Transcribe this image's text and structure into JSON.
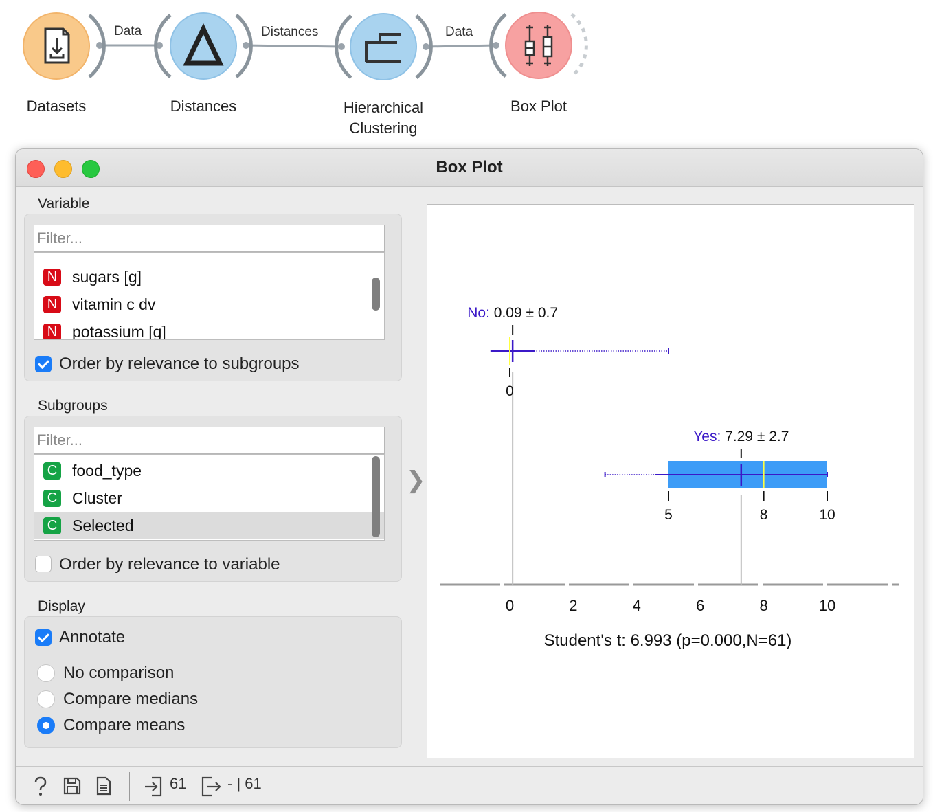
{
  "workflow": {
    "nodes": [
      {
        "label": "Datasets",
        "icon": "dataset-file-icon",
        "color": "#f9c98a"
      },
      {
        "label": "Distances",
        "icon": "triangle-delta-icon",
        "color": "#a9d3ef"
      },
      {
        "label_line1": "Hierarchical",
        "label_line2": "Clustering",
        "icon": "dendrogram-icon",
        "color": "#a9d3ef"
      },
      {
        "label": "Box Plot",
        "icon": "box-plot-icon",
        "color": "#f7a1a1"
      }
    ],
    "links": [
      "Data",
      "Distances",
      "Data"
    ]
  },
  "window": {
    "title": "Box Plot",
    "colors": {
      "close": "#fe5f57",
      "minimize": "#febc2e",
      "maximize": "#28c840"
    }
  },
  "variable": {
    "section_title": "Variable",
    "filter_placeholder": "Filter...",
    "items": [
      {
        "badge": "N",
        "label": "sugars [g]"
      },
      {
        "badge": "N",
        "label": "vitamin c dv"
      },
      {
        "badge": "N",
        "label": "potassium [g]"
      }
    ],
    "order_checkbox": {
      "label": "Order by relevance to subgroups",
      "checked": true
    }
  },
  "subgroups": {
    "section_title": "Subgroups",
    "filter_placeholder": "Filter...",
    "items": [
      {
        "badge": "C",
        "label": "food_type"
      },
      {
        "badge": "C",
        "label": "Cluster"
      },
      {
        "badge": "C",
        "label": "Selected",
        "selected": true
      }
    ],
    "order_checkbox": {
      "label": "Order by relevance to variable",
      "checked": false
    }
  },
  "display": {
    "section_title": "Display",
    "annotate": {
      "label": "Annotate",
      "checked": true
    },
    "comparison_options": [
      {
        "label": "No comparison",
        "selected": false
      },
      {
        "label": "Compare medians",
        "selected": false
      },
      {
        "label": "Compare means",
        "selected": true
      }
    ]
  },
  "chart_data": {
    "type": "box",
    "xlim": [
      -1,
      12
    ],
    "axis_ticks": [
      0,
      2,
      4,
      6,
      8,
      10
    ],
    "boxes": [
      {
        "name": "No",
        "label_value": "0.09 ± 0.7",
        "mean": 0.09,
        "sd": 0.7,
        "median": 0,
        "q1": 0,
        "q3": 0,
        "whisker_low": 0,
        "whisker_high": 0,
        "outlier_low": 0,
        "outlier_high": 5,
        "tick_labels": [
          "0"
        ]
      },
      {
        "name": "Yes",
        "label_value": "7.29 ± 2.7",
        "mean": 7.29,
        "sd": 2.7,
        "median": 8,
        "q1": 5,
        "q3": 10,
        "whisker_low": 5,
        "whisker_high": 10,
        "outlier_low": 3,
        "outlier_high": 10,
        "tick_labels": [
          "5",
          "8",
          "10"
        ]
      }
    ],
    "statistic": "Student's t: 6.993 (p=0.000,N=61)",
    "colors": {
      "box": "#3d9cf7",
      "mean": "#3b19c8",
      "median": "#ffff40",
      "label_name": "#3b19c8"
    }
  },
  "statusbar": {
    "input_count": "61",
    "output_count": "- | 61"
  }
}
